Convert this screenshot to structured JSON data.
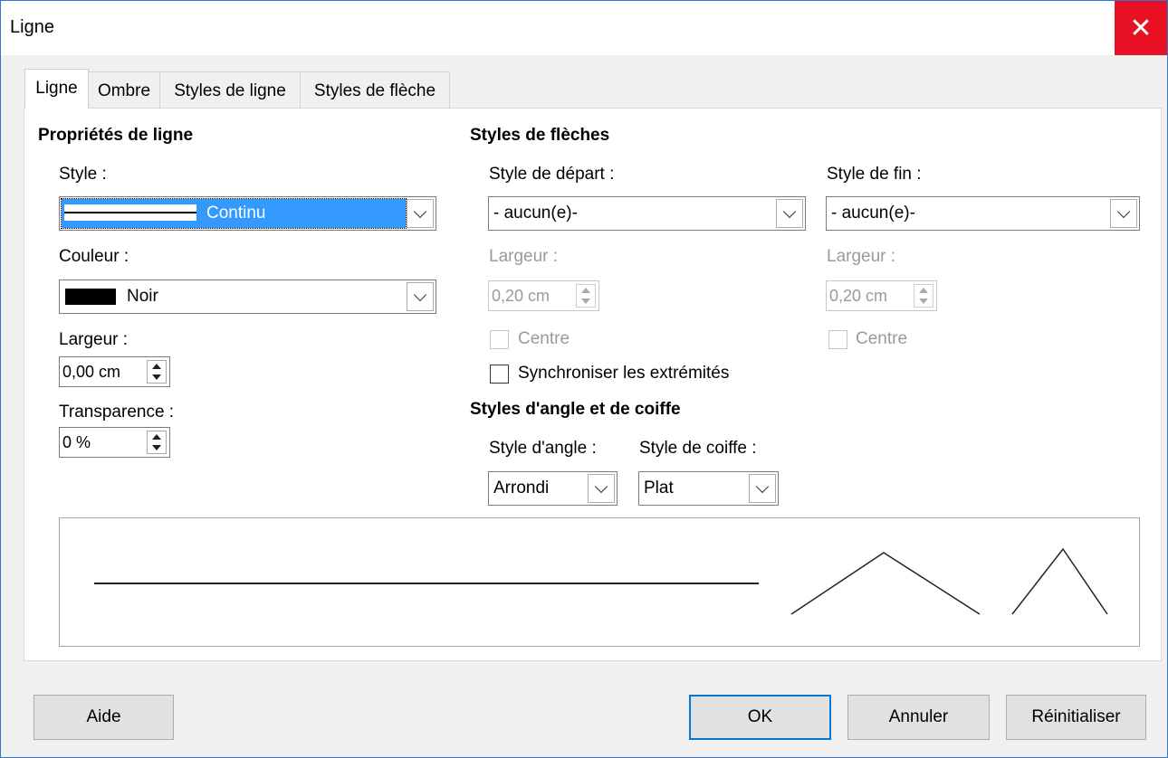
{
  "window": {
    "title": "Ligne",
    "close_glyph": "✕"
  },
  "tabs": [
    {
      "label": "Ligne",
      "active": true
    },
    {
      "label": "Ombre",
      "active": false
    },
    {
      "label": "Styles de ligne",
      "active": false
    },
    {
      "label": "Styles de flèche",
      "active": false
    }
  ],
  "line_props": {
    "heading": "Propriétés de ligne",
    "style_label": "Style :",
    "style_value": "Continu",
    "color_label": "Couleur :",
    "color_value": "Noir",
    "color_swatch": "#000000",
    "width_label": "Largeur :",
    "width_value": "0,00 cm",
    "transparency_label": "Transparence :",
    "transparency_value": "0 %"
  },
  "arrows": {
    "heading": "Styles de flèches",
    "start_label": "Style de départ :",
    "start_value": "- aucun(e)-",
    "end_label": "Style de fin :",
    "end_value": "- aucun(e)-",
    "start_width_label": "Largeur :",
    "start_width_value": "0,20 cm",
    "end_width_label": "Largeur :",
    "end_width_value": "0,20 cm",
    "start_center_label": "Centre",
    "end_center_label": "Centre",
    "sync_label": "Synchroniser les extrémités"
  },
  "corner": {
    "heading": "Styles d'angle et de coiffe",
    "angle_label": "Style d'angle :",
    "angle_value": "Arrondi",
    "cap_label": "Style de coiffe :",
    "cap_value": "Plat"
  },
  "buttons": {
    "help": "Aide",
    "ok": "OK",
    "cancel": "Annuler",
    "reset": "Réinitialiser"
  },
  "colors": {
    "accent": "#0078d7",
    "close": "#e81123",
    "selection": "#3399ff"
  }
}
